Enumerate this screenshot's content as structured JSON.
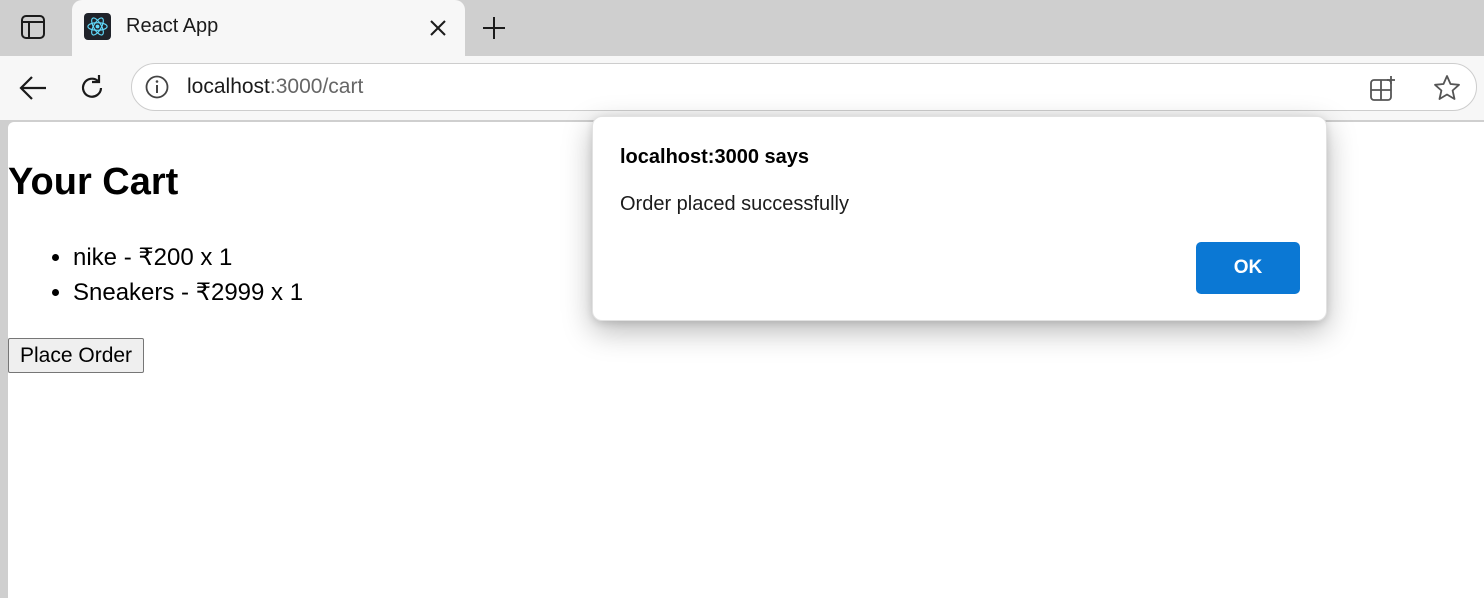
{
  "browser": {
    "tab": {
      "title": "React App",
      "favicon": "react-logo-icon"
    },
    "address_bar": {
      "host": "localhost",
      "path": ":3000/cart"
    },
    "colors": {
      "tab_strip": "#cfcfcf",
      "toolbar": "#f7f7f7",
      "accent": "#0b78d4"
    }
  },
  "page": {
    "heading": "Your Cart",
    "cart_items": [
      "nike - ₹200 x 1",
      "Sneakers - ₹2999 x 1"
    ],
    "place_order_label": "Place Order"
  },
  "alert": {
    "title": "localhost:3000 says",
    "message": "Order placed successfully",
    "ok_label": "OK"
  }
}
